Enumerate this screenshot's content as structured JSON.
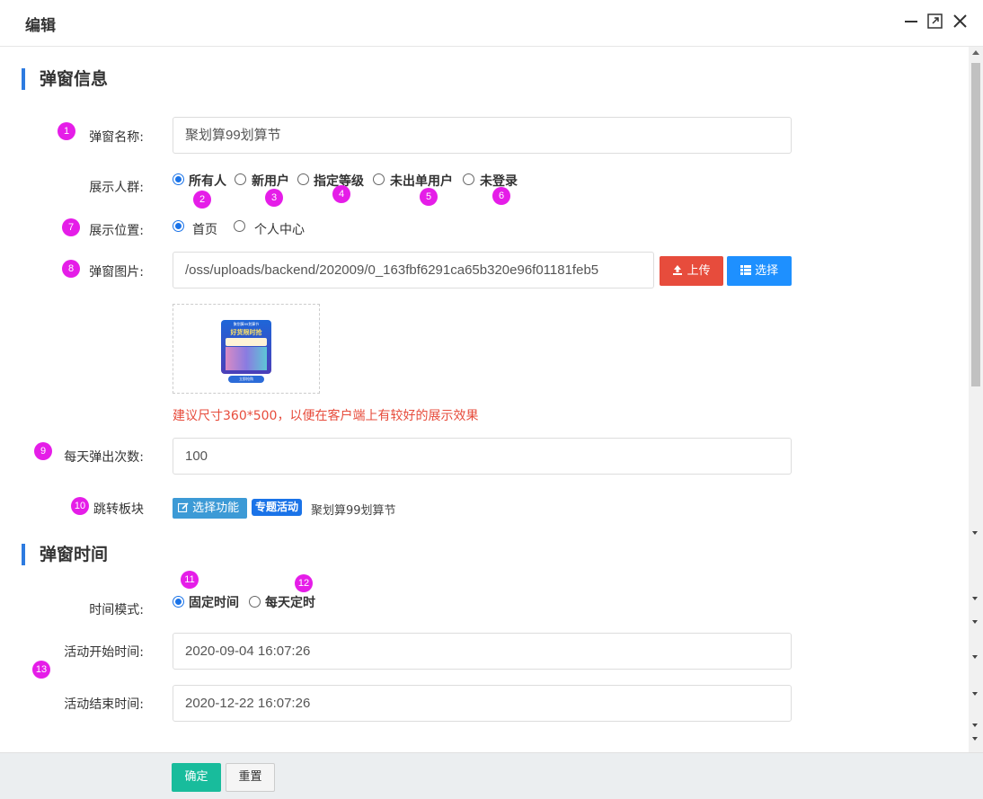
{
  "window": {
    "title": "编辑"
  },
  "section1": {
    "title": "弹窗信息"
  },
  "section2": {
    "title": "弹窗时间"
  },
  "fields": {
    "name": {
      "label": "弹窗名称:",
      "value": "聚划算99划算节"
    },
    "audience": {
      "label": "展示人群:",
      "options": [
        "所有人",
        "新用户",
        "指定等级",
        "未出单用户",
        "未登录"
      ]
    },
    "position": {
      "label": "展示位置:",
      "options": [
        "首页",
        "个人中心"
      ]
    },
    "image": {
      "label": "弹窗图片:",
      "value": "/oss/uploads/backend/202009/0_163fbf6291ca65b320e96f01181feb5",
      "upload_label": "上传",
      "select_label": "选择",
      "hint": "建议尺寸360*500，以便在客户端上有较好的展示效果"
    },
    "daily": {
      "label": "每天弹出次数:",
      "value": "100"
    },
    "jump": {
      "label": "跳转板块",
      "select_label": "选择功能",
      "tag": "专题活动",
      "target": "聚划算99划算节"
    },
    "time_mode": {
      "label": "时间模式:",
      "options": [
        "固定时间",
        "每天定时"
      ]
    },
    "start": {
      "label": "活动开始时间:",
      "value": "2020-09-04 16:07:26"
    },
    "end": {
      "label": "活动结束时间:",
      "value": "2020-12-22 16:07:26"
    }
  },
  "badges": [
    "1",
    "2",
    "3",
    "4",
    "5",
    "6",
    "7",
    "8",
    "9",
    "10",
    "11",
    "12",
    "13"
  ],
  "preview": {
    "line1": "聚划算99划算节",
    "line2": "好货限时抢",
    "button": "立即抢购"
  },
  "footer": {
    "confirm": "确定",
    "reset": "重置"
  },
  "colors": {
    "accent": "#1a73e8",
    "badge": "#e51de8",
    "upload": "#e74c3c",
    "select": "#1e90ff",
    "confirm": "#18bc9c"
  }
}
